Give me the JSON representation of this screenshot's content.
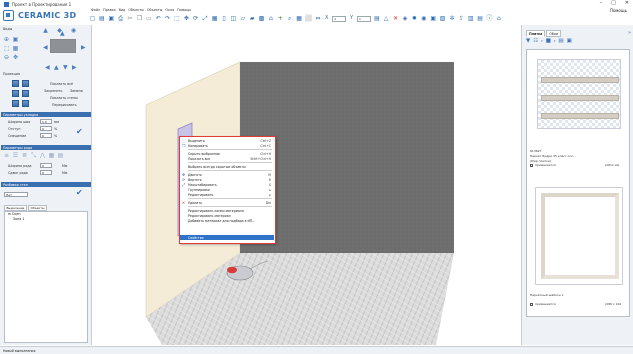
{
  "window": {
    "title": "Проект в Проектирование 1",
    "minimize": "–",
    "maximize": "□",
    "close": "✕",
    "help": "Помощь"
  },
  "app": {
    "logo_text": "CERAMIC 3D"
  },
  "menu": [
    "Файл",
    "Правка",
    "Вид",
    "Объекты",
    "Объекты",
    "Окна",
    "Помощь"
  ],
  "toolbar": {
    "field1": "1",
    "field2": "1"
  },
  "left_panel": {
    "view_label": "Виды",
    "projection_label": "Проекция",
    "show_room": "Показать всё",
    "bind": "Закрепить",
    "replace": "Замена",
    "show_walls": "Показать стены",
    "redraw": "Перерисовать",
    "section_tile": "Параметры укладки",
    "seam_width_label": "Ширина шва",
    "seam_width_value": "1.0",
    "seam_width_unit": "мм",
    "offset_label": "Отступ",
    "offset_value": "0",
    "offset_unit": "%",
    "shift_label": "Смещение",
    "shift_value": "0",
    "shift_unit": "%",
    "section_layout": "Параметры ряда",
    "row_width_label": "Ширина ряда",
    "row_width_value": "0",
    "row_width_unit": "Мм",
    "row_shift_label": "Сдвиг ряда",
    "row_shift_value": "0",
    "row_shift_unit": "Мм",
    "section_wall": "Разбивка стен",
    "wall_select_value": "Нет",
    "tab_selection": "Выделение",
    "tab_objects": "Объекты",
    "tree_root": "Сцен",
    "tree_child": "Зона 1"
  },
  "context_menu": {
    "items": [
      {
        "label": "Выделить",
        "shortcut": "Ctrl+Z",
        "icon": "select-icon"
      },
      {
        "label": "Копировать",
        "shortcut": "Ctrl+C",
        "icon": "copy-icon"
      },
      {
        "label": "Скрыть выбранное",
        "shortcut": "Ctrl+H",
        "icon": ""
      },
      {
        "label": "Показать все",
        "shortcut": "Shift+Ctrl+H",
        "icon": ""
      },
      {
        "label": "Выбрать всегда скрытые объекты",
        "shortcut": "",
        "icon": ""
      },
      {
        "label": "Двигать",
        "shortcut": "M",
        "icon": "move-icon"
      },
      {
        "label": "Вертеть",
        "shortcut": "R",
        "icon": "rotate-icon"
      },
      {
        "label": "Масштабировать",
        "shortcut": "S",
        "icon": "scale-icon"
      },
      {
        "label": "Группировка",
        "shortcut": "",
        "icon": ""
      },
      {
        "label": "Редактировать",
        "shortcut": "",
        "icon": ""
      },
      {
        "label": "Удалить",
        "shortcut": "Del",
        "icon": "delete-icon"
      },
      {
        "label": "Редактировать копии материала",
        "shortcut": "",
        "icon": ""
      },
      {
        "label": "Редактировать материал",
        "shortcut": "",
        "icon": ""
      },
      {
        "label": "Добавить материал для подбора в ИП...",
        "shortcut": "",
        "icon": ""
      },
      {
        "label": "Свойства",
        "shortcut": "",
        "icon": ""
      }
    ],
    "selected_index": 14
  },
  "right_panel": {
    "tab_catalog": "Плитка",
    "tab_other": "Обои",
    "item1_code": "613627",
    "item1_name": "Паркет Будри 25 класс оск...",
    "item1_sub": "(Мир плитки)",
    "item1_check": "применяется",
    "item1_size": "(281x мм",
    "item2_name": "Паркетный шаблон 1",
    "item2_check": "применяется",
    "item2_size": "(486 x 120"
  },
  "statusbar": {
    "text": "Новый выполнения"
  },
  "colors": {
    "accent": "#3a6fb0",
    "menu_border": "#e03a3a",
    "selection": "#2f73c8",
    "wall_left": "#f3ead2",
    "wall_back": "#6b6b6b",
    "floor": "#dcdcdc"
  }
}
